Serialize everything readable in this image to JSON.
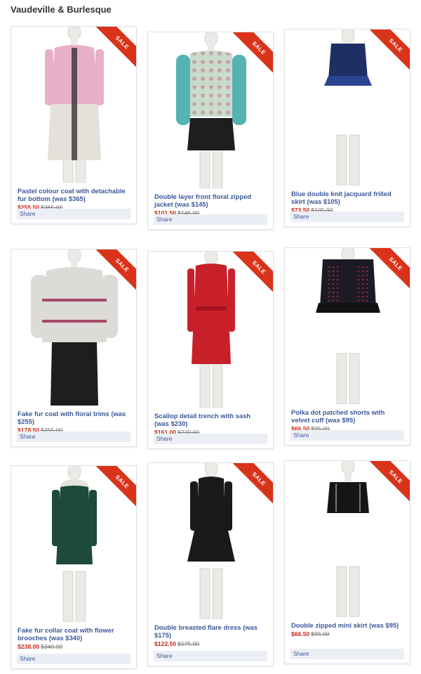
{
  "page": {
    "title": "Vaudeville & Burlesque"
  },
  "sale_label": "SALE",
  "share_label": "Share",
  "products": [
    {
      "title": "Pastel colour coat with detachable fur bottom (was $365)",
      "price": "$255.50",
      "old_price": "$365.00",
      "garment": "coat",
      "color": "#e8b0c8",
      "color2": "#e4e0da"
    },
    {
      "title": "Double layer front floral zipped jacket (was $145)",
      "price": "$101.50",
      "old_price": "$145.00",
      "garment": "jacket",
      "color": "#56b3b4",
      "color2": "#1e1e1e"
    },
    {
      "title": "Blue double knit jacquard frilled skirt (was $105)",
      "price": "$73.50",
      "old_price": "$105.00",
      "garment": "skirt",
      "color": "#1e2f63",
      "color2": "#1e2f63"
    },
    {
      "title": "Fake fur coat with floral trims (was $255)",
      "price": "$178.50",
      "old_price": "$255.00",
      "garment": "fur",
      "color": "#dcdbd7",
      "color2": "#1e1e1e"
    },
    {
      "title": "Scallop detail trench with sash (was $230)",
      "price": "$161.00",
      "old_price": "$230.00",
      "garment": "trench",
      "color": "#c8202a",
      "color2": "#c8202a"
    },
    {
      "title": "Polka dot patched shorts with velvet cuff (was $95)",
      "price": "$66.50",
      "old_price": "$95.00",
      "garment": "shorts",
      "color": "#1c1a24",
      "color2": "#7a2a3a"
    },
    {
      "title": "Fake fur collar coat with flower brooches (was $340)",
      "price": "$238.00",
      "old_price": "$340.00",
      "garment": "longcoat",
      "color": "#1d4a3a",
      "color2": "#e6e2dc"
    },
    {
      "title": "Double breasted flare dress (was $175)",
      "price": "$122.50",
      "old_price": "$175.00",
      "garment": "dress",
      "color": "#1a1a1a",
      "color2": "#1a1a1a"
    },
    {
      "title": "Double zipped mini skirt (was $95)",
      "price": "$66.50",
      "old_price": "$95.00",
      "garment": "mini",
      "color": "#151515",
      "color2": "#151515"
    }
  ]
}
